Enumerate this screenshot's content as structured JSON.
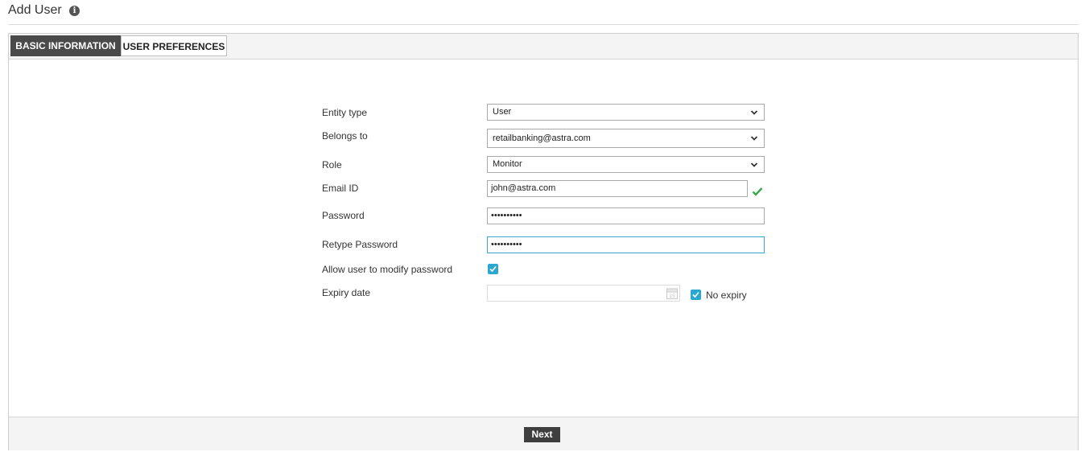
{
  "header": {
    "title": "Add User",
    "info_icon": "info-icon"
  },
  "tabs": [
    {
      "label": "BASIC INFORMATION",
      "active": true
    },
    {
      "label": "USER PREFERENCES",
      "active": false
    }
  ],
  "form": {
    "entity_type": {
      "label": "Entity type",
      "value": "User"
    },
    "belongs_to": {
      "label": "Belongs to",
      "value": "retailbanking@astra.com"
    },
    "role": {
      "label": "Role",
      "value": "Monitor"
    },
    "email": {
      "label": "Email ID",
      "value": "john@astra.com",
      "valid": true
    },
    "password": {
      "label": "Password",
      "value": "••••••••••"
    },
    "retype_password": {
      "label": "Retype Password",
      "value": "••••••••••"
    },
    "allow_modify": {
      "label": "Allow user to modify password",
      "checked": true
    },
    "expiry": {
      "label": "Expiry date",
      "value": "",
      "no_expiry_label": "No expiry",
      "no_expiry_checked": true
    }
  },
  "footer": {
    "next_label": "Next"
  },
  "colors": {
    "accent": "#2aa8cf",
    "tab_active": "#4a4a4a",
    "valid_check": "#3aa84a",
    "button": "#3e3e3e"
  }
}
